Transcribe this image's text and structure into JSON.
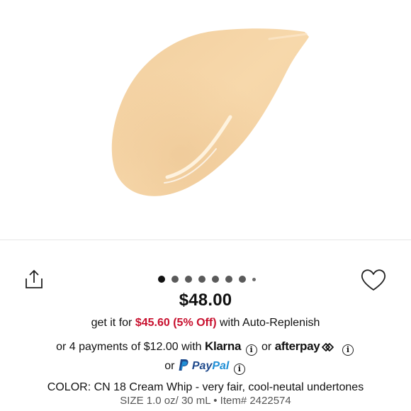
{
  "product": {
    "image_alt": "foundation swatch",
    "swatch_color": "#f5d3a4",
    "price": "$48.00"
  },
  "carousel": {
    "total_dots": 7,
    "active_index": 0,
    "has_more": true
  },
  "auto_replenish": {
    "prefix": "get it for",
    "sale_price": "$45.60 (5% Off)",
    "suffix": "with Auto-Replenish",
    "sale_color": "#c8102e"
  },
  "installments": {
    "prefix": "or 4 payments of $12.00 with",
    "klarna_label": "Klarna",
    "or_text": "or",
    "afterpay_label": "afterpay"
  },
  "paypal": {
    "prefix": "or",
    "pay": "Pay",
    "pal": "Pal"
  },
  "details": {
    "color_line": "COLOR: CN 18 Cream Whip - very fair, cool-neutal undertones",
    "size_line": "SIZE 1.0 oz/ 30 mL • Item# 2422574"
  },
  "icons": {
    "share": "share-icon",
    "heart": "heart-icon",
    "info": "info-icon",
    "paypal": "paypal-icon",
    "afterpay": "afterpay-arrows-icon"
  }
}
